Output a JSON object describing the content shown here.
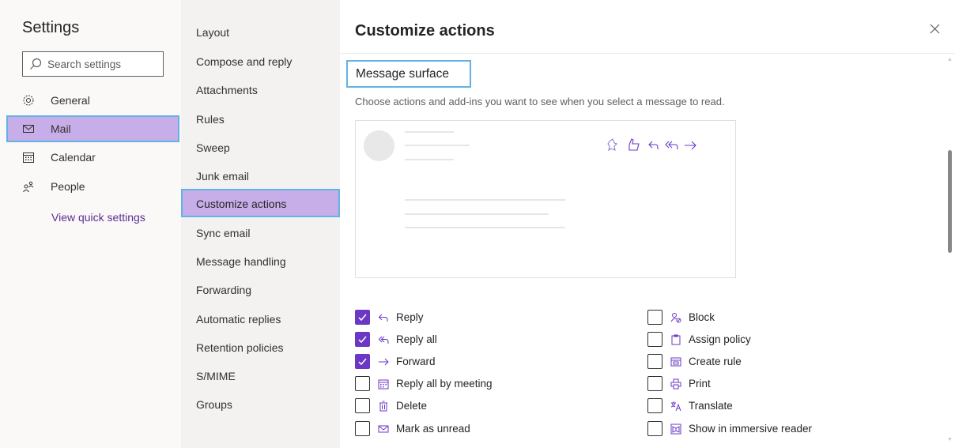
{
  "left": {
    "title": "Settings",
    "search_placeholder": "Search settings",
    "items": [
      {
        "label": "General",
        "icon": "gear-icon"
      },
      {
        "label": "Mail",
        "icon": "mail-icon"
      },
      {
        "label": "Calendar",
        "icon": "calendar-icon"
      },
      {
        "label": "People",
        "icon": "people-icon"
      }
    ],
    "quick_settings": "View quick settings"
  },
  "middle": {
    "items": [
      "Layout",
      "Compose and reply",
      "Attachments",
      "Rules",
      "Sweep",
      "Junk email",
      "Customize actions",
      "Sync email",
      "Message handling",
      "Forwarding",
      "Automatic replies",
      "Retention policies",
      "S/MIME",
      "Groups"
    ],
    "active": "Customize actions"
  },
  "right": {
    "title": "Customize actions",
    "section_title": "Message surface",
    "description": "Choose actions and add-ins you want to see when you select a message to read.",
    "options_left": [
      {
        "label": "Reply",
        "checked": true,
        "icon": "reply-icon"
      },
      {
        "label": "Reply all",
        "checked": true,
        "icon": "reply-all-icon"
      },
      {
        "label": "Forward",
        "checked": true,
        "icon": "forward-icon"
      },
      {
        "label": "Reply all by meeting",
        "checked": false,
        "icon": "calendar-icon"
      },
      {
        "label": "Delete",
        "checked": false,
        "icon": "trash-icon"
      },
      {
        "label": "Mark as unread",
        "checked": false,
        "icon": "mail-icon"
      }
    ],
    "options_right": [
      {
        "label": "Block",
        "checked": false,
        "icon": "block-person-icon"
      },
      {
        "label": "Assign policy",
        "checked": false,
        "icon": "policy-icon"
      },
      {
        "label": "Create rule",
        "checked": false,
        "icon": "rule-icon"
      },
      {
        "label": "Print",
        "checked": false,
        "icon": "print-icon"
      },
      {
        "label": "Translate",
        "checked": false,
        "icon": "translate-icon"
      },
      {
        "label": "Show in immersive reader",
        "checked": false,
        "icon": "immersive-reader-icon"
      }
    ]
  },
  "colors": {
    "accent": "#6b38c6",
    "selection": "#c8aee8",
    "focus_border": "#62b3e4"
  }
}
